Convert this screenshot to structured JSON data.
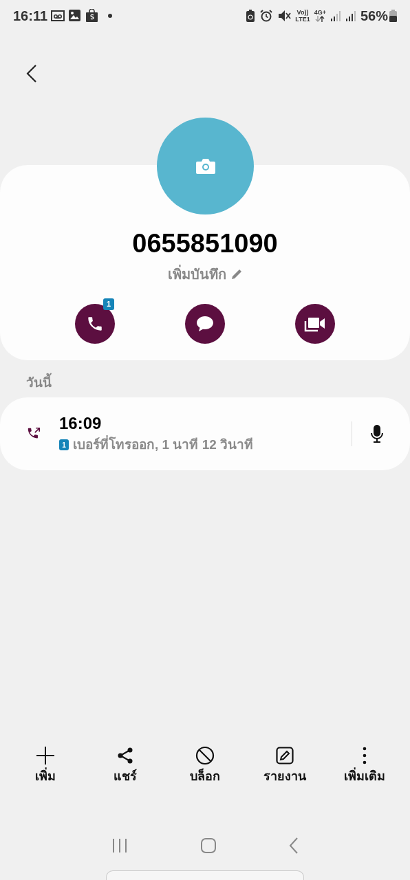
{
  "status_bar": {
    "time": "16:11",
    "volte_top": "Vo))",
    "volte_bottom": "LTE1",
    "network": "4G+",
    "battery": "56%"
  },
  "contact": {
    "number": "0655851090",
    "note": "เพิ่มบันทึก"
  },
  "actions": [
    {
      "kind": "call",
      "badge": "1"
    },
    {
      "kind": "message"
    },
    {
      "kind": "video"
    }
  ],
  "history": {
    "heading": "วันนี้",
    "entries": [
      {
        "time": "16:09",
        "sim": "1",
        "detail": "เบอร์ที่โทรออก, 1 นาที 12 วินาที"
      }
    ]
  },
  "toolbar": [
    {
      "kind": "add",
      "label": "เพิ่ม"
    },
    {
      "kind": "share",
      "label": "แชร์"
    },
    {
      "kind": "block",
      "label": "บล็อก"
    },
    {
      "kind": "report",
      "label": "รายงาน"
    },
    {
      "kind": "more",
      "label": "เพิ่มเติม"
    }
  ]
}
